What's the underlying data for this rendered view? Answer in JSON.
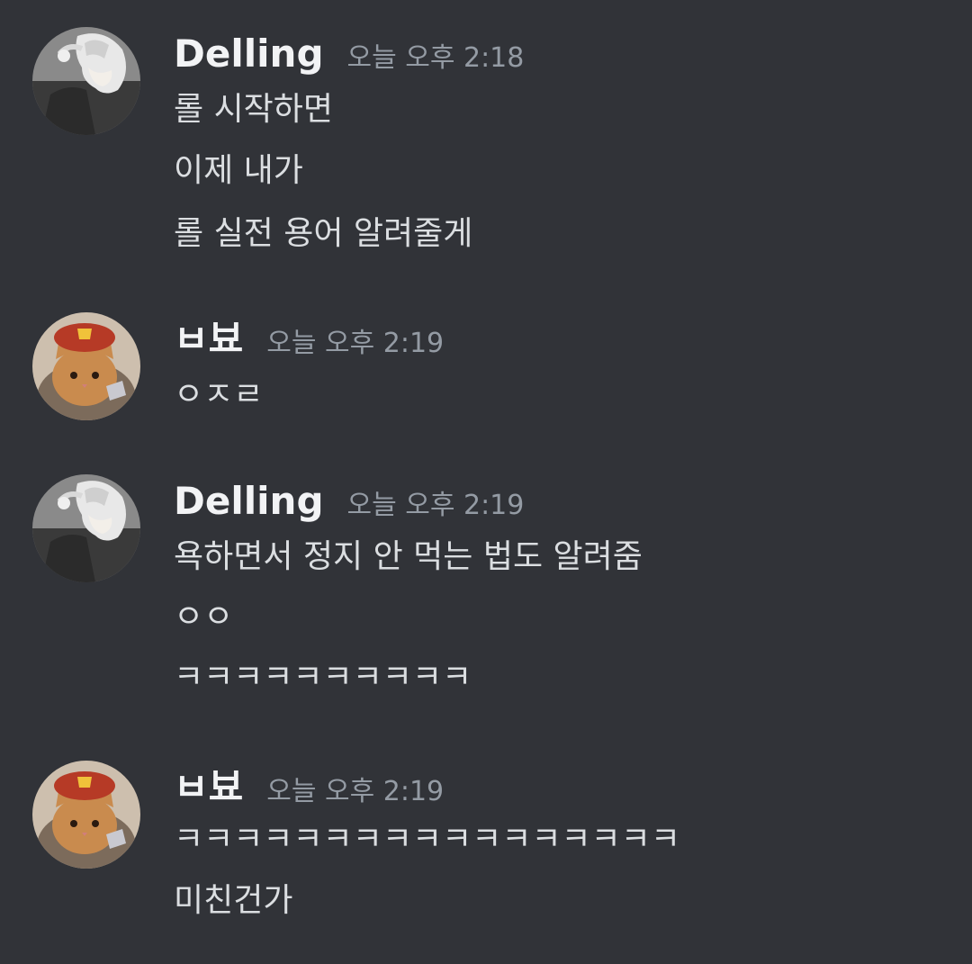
{
  "messages": [
    {
      "author": "Delling",
      "time": "오늘 오후 2:18",
      "avatar_icon": "silver-haired-character-avatar",
      "lines": [
        "롤 시작하면",
        "이제 내가",
        "롤 실전 용어 알려줄게"
      ]
    },
    {
      "author": "ㅂ뵤",
      "time": "오늘 오후 2:19",
      "avatar_icon": "cat-with-red-beret-avatar",
      "lines": [
        "ㅇㅈㄹ"
      ]
    },
    {
      "author": "Delling",
      "time": "오늘 오후 2:19",
      "avatar_icon": "silver-haired-character-avatar",
      "lines": [
        "욕하면서 정지 안 먹는 법도 알려줌",
        "ㅇㅇ",
        "ㅋㅋㅋㅋㅋㅋㅋㅋㅋㅋ"
      ]
    },
    {
      "author": "ㅂ뵤",
      "time": "오늘 오후 2:19",
      "avatar_icon": "cat-with-red-beret-avatar",
      "lines": [
        "ㅋㅋㅋㅋㅋㅋㅋㅋㅋㅋㅋㅋㅋㅋㅋㅋㅋ",
        "미친건가"
      ]
    }
  ]
}
